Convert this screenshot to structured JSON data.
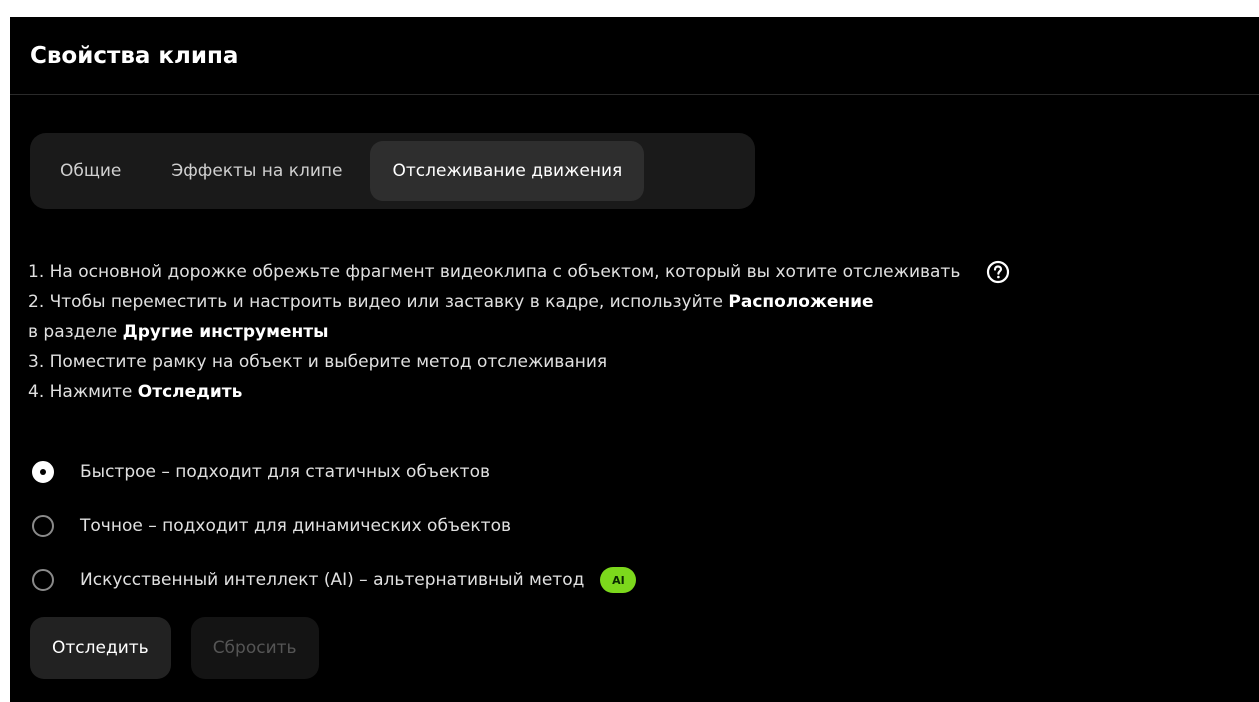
{
  "window": {
    "title": "Свойства клипа"
  },
  "tabs": [
    {
      "label": "Общие",
      "active": false
    },
    {
      "label": "Эффекты на клипе",
      "active": false
    },
    {
      "label": "Отслеживание движения",
      "active": true
    }
  ],
  "instructions": {
    "line1": "1. На основной дорожке обрежьте фрагмент видеоклипа с объектом, который вы хотите отслеживать",
    "line2_prefix": "2. Чтобы переместить и настроить видео или заставку в кадре, используйте ",
    "line2_bold": "Расположение",
    "line3_prefix": "в разделе ",
    "line3_bold": "Другие инструменты",
    "line4": "3. Поместите рамку на объект и выберите метод отслеживания",
    "line5_prefix": "4. Нажмите ",
    "line5_bold": "Отследить",
    "help_icon": "question-circle-icon"
  },
  "methods": {
    "selected": 0,
    "options": [
      {
        "label": "Быстрое – подходит для статичных объектов"
      },
      {
        "label": "Точное – подходит для динамических объектов"
      },
      {
        "label": "Искусственный интеллект (AI) – альтернативный метод",
        "badge": "AI"
      }
    ]
  },
  "buttons": {
    "track_label": "Отследить",
    "reset_label": "Сбросить"
  },
  "colors": {
    "background": "#000000",
    "ai_badge": "#7cd81c",
    "active_tab": "#2e2e2e"
  }
}
